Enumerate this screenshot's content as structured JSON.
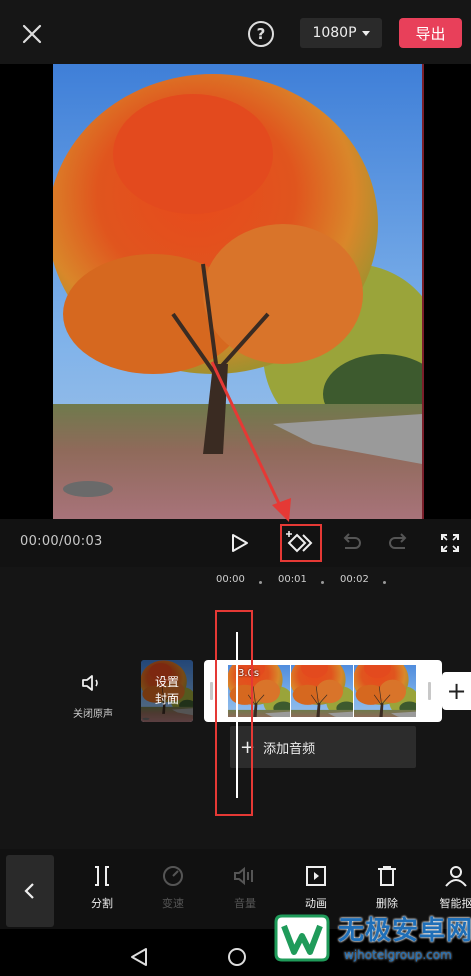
{
  "header": {
    "close_icon": "close-icon",
    "help_icon": "help-icon",
    "help_label": "?",
    "resolution": "1080P",
    "export_label": "导出"
  },
  "controls": {
    "timecode": "00:00/00:03",
    "icons": [
      "play-icon",
      "add-keyframe-icon",
      "undo-icon",
      "redo-icon",
      "fullscreen-icon"
    ]
  },
  "timeline": {
    "ticks": [
      "00:00",
      "00:01",
      "00:02"
    ],
    "mute_label": "关闭原声",
    "cover_line1": "设置",
    "cover_line2": "封面",
    "clip_duration": "3.0s",
    "add_audio_label": "添加音频",
    "add_clip_symbol": "+"
  },
  "toolbar": {
    "items": [
      {
        "label": "分割",
        "icon": "split-icon",
        "enabled": true
      },
      {
        "label": "变速",
        "icon": "speed-icon",
        "enabled": false
      },
      {
        "label": "音量",
        "icon": "volume-icon",
        "enabled": false
      },
      {
        "label": "动画",
        "icon": "animation-icon",
        "enabled": true
      },
      {
        "label": "删除",
        "icon": "delete-icon",
        "enabled": true
      },
      {
        "label": "智能抠",
        "icon": "smart-cutout-icon",
        "enabled": true
      }
    ]
  },
  "watermark": {
    "title": "无极安卓网",
    "url": "wjhotelgroup.com"
  },
  "colors": {
    "accent": "#e8405a",
    "highlight": "#e53935",
    "watermark": "#1f6fb8"
  }
}
